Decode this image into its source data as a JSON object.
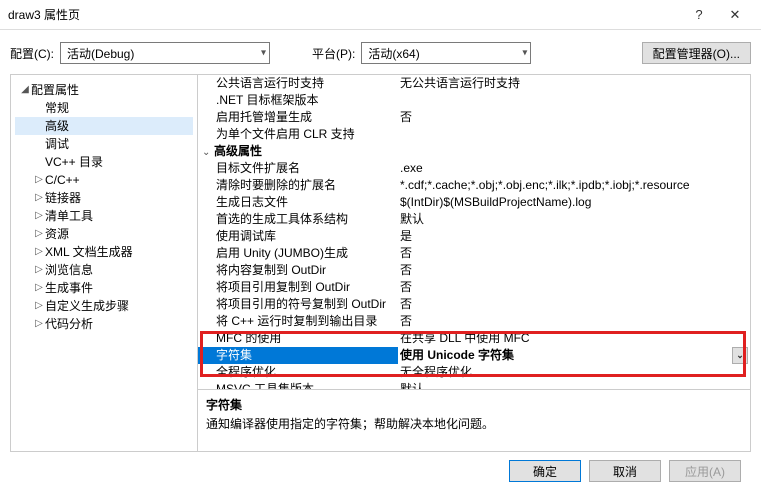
{
  "title": "draw3 属性页",
  "config": {
    "label": "配置(C):",
    "value": "活动(Debug)",
    "platform_label": "平台(P):",
    "platform_value": "活动(x64)",
    "manager_btn": "配置管理器(O)..."
  },
  "tree": {
    "root": "配置属性",
    "items": [
      "常规",
      "高级",
      "调试",
      "VC++ 目录",
      "C/C++",
      "链接器",
      "清单工具",
      "资源",
      "XML 文档生成器",
      "浏览信息",
      "生成事件",
      "自定义生成步骤",
      "代码分析"
    ],
    "selected": "高级",
    "expandable": [
      "C/C++",
      "链接器",
      "清单工具",
      "资源",
      "XML 文档生成器",
      "浏览信息",
      "生成事件",
      "自定义生成步骤",
      "代码分析"
    ]
  },
  "grid": {
    "rows": [
      {
        "k": "公共语言运行时支持",
        "v": "无公共语言运行时支持"
      },
      {
        "k": ".NET 目标框架版本",
        "v": ""
      },
      {
        "k": "启用托管增量生成",
        "v": "否"
      },
      {
        "k": "为单个文件启用 CLR 支持",
        "v": ""
      }
    ],
    "group": "高级属性",
    "rows2": [
      {
        "k": "目标文件扩展名",
        "v": ".exe"
      },
      {
        "k": "清除时要删除的扩展名",
        "v": "*.cdf;*.cache;*.obj;*.obj.enc;*.ilk;*.ipdb;*.iobj;*.resource"
      },
      {
        "k": "生成日志文件",
        "v": "$(IntDir)$(MSBuildProjectName).log"
      },
      {
        "k": "首选的生成工具体系结构",
        "v": "默认"
      },
      {
        "k": "使用调试库",
        "v": "是"
      },
      {
        "k": "启用 Unity (JUMBO)生成",
        "v": "否"
      },
      {
        "k": "将内容复制到 OutDir",
        "v": "否"
      },
      {
        "k": "将项目引用复制到 OutDir",
        "v": "否"
      },
      {
        "k": "将项目引用的符号复制到 OutDir",
        "v": "否"
      },
      {
        "k": "将 C++ 运行时复制到输出目录",
        "v": "否"
      },
      {
        "k": "MFC 的使用",
        "v": "在共享 DLL 中使用 MFC"
      },
      {
        "k": "字符集",
        "v": "使用 Unicode 字符集",
        "sel": true
      },
      {
        "k": "全程序优化",
        "v": "无全程序优化"
      },
      {
        "k": "MSVC 工具集版本",
        "v": "默认"
      }
    ]
  },
  "desc": {
    "title": "字符集",
    "body": "通知编译器使用指定的字符集；帮助解决本地化问题。"
  },
  "buttons": {
    "ok": "确定",
    "cancel": "取消",
    "apply": "应用(A)"
  }
}
